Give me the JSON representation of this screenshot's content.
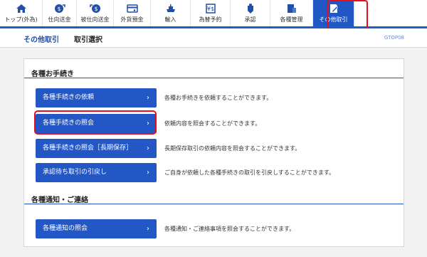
{
  "nav": {
    "tabs": [
      {
        "label": "トップ(外為)",
        "icon": "home-icon"
      },
      {
        "label": "仕向送金",
        "icon": "outward-remittance-icon"
      },
      {
        "label": "被仕向送金",
        "icon": "inward-remittance-icon"
      },
      {
        "label": "外貨預金",
        "icon": "fx-deposit-icon"
      },
      {
        "label": "輸入",
        "icon": "import-icon"
      },
      {
        "label": "為替予約",
        "icon": "fx-contract-icon"
      },
      {
        "label": "承認",
        "icon": "approval-icon"
      },
      {
        "label": "各種管理",
        "icon": "management-icon"
      },
      {
        "label": "その他取引",
        "icon": "other-transactions-icon"
      }
    ],
    "active_index": 8,
    "accent": "#2057c4",
    "highlight": "#e2101a"
  },
  "header": {
    "section": "その他取引",
    "page": "取引選択",
    "code": "GTOP08"
  },
  "procedures": {
    "title": "各種お手続き",
    "items": [
      {
        "label": "各種手続きの依頼",
        "arrow": "›",
        "desc": "各種お手続きを依頼することができます。"
      },
      {
        "label": "各種手続きの照会",
        "arrow": "›",
        "desc": "依頼内容を照会することができます。"
      },
      {
        "label": "各種手続きの照会［長期保存］",
        "arrow": "›",
        "desc": "長期保存取引の依頼内容を照会することができます。"
      },
      {
        "label": "承認待ち取引の引戻し",
        "arrow": "›",
        "desc": "ご自身が依頼した各種手続きの取引を引戻しすることができます。"
      }
    ]
  },
  "notices": {
    "title": "各種通知・ご連絡",
    "items": [
      {
        "label": "各種通知の照会",
        "arrow": "›",
        "desc": "各種通知・ご連絡事項を照会することができます。"
      }
    ]
  }
}
